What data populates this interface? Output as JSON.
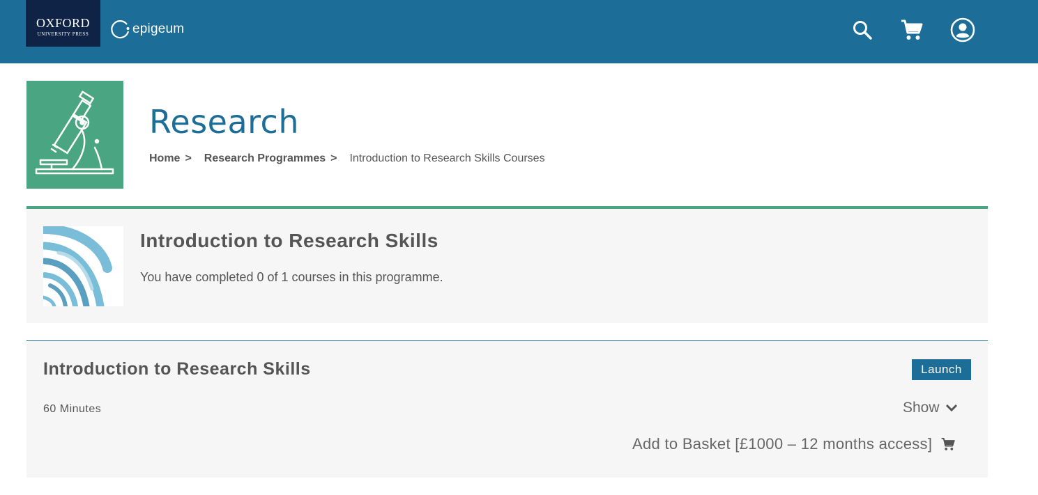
{
  "header": {
    "oup_line1": "OXFORD",
    "oup_line2": "UNIVERSITY PRESS",
    "epigeum_text": "epigeum",
    "icons": [
      "search-icon",
      "cart-icon",
      "account-icon"
    ]
  },
  "programme": {
    "title": "Research",
    "icon": "microscope-icon",
    "breadcrumb": {
      "home": "Home",
      "sep": ">",
      "programmes": "Research Programmes",
      "current": "Introduction to Research Skills Courses"
    }
  },
  "summary": {
    "title": "Introduction to Research Skills",
    "progress_text": "You have completed 0 of 1 courses in this programme."
  },
  "course": {
    "title": "Introduction to Research Skills",
    "launch_label": "Launch",
    "duration": "60 Minutes",
    "show_label": "Show",
    "basket_label": "Add to Basket [£1000 – 12 months access]"
  },
  "colors": {
    "header_bg": "#1c6d98",
    "oup_bg": "#0f2347",
    "programme_green": "#4aa682",
    "panel_bg": "#f6f6f6"
  }
}
